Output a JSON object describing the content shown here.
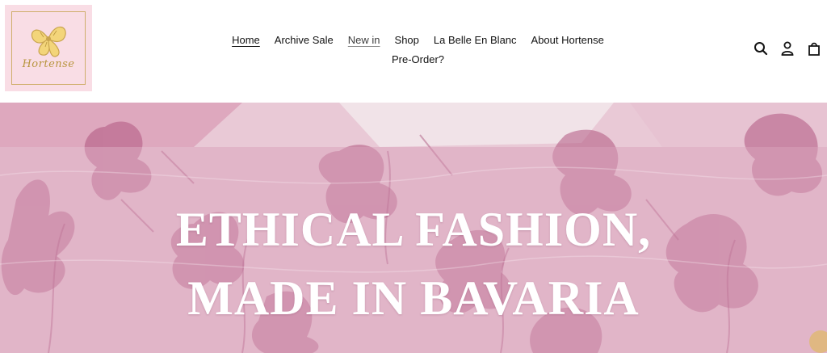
{
  "brand": {
    "logo_text": "Hortense"
  },
  "nav": {
    "items": [
      {
        "label": "Home"
      },
      {
        "label": "Archive Sale"
      },
      {
        "label": "New in"
      },
      {
        "label": "Shop"
      },
      {
        "label": "La Belle En Blanc"
      },
      {
        "label": "About Hortense"
      },
      {
        "label": "Pre-Order?"
      }
    ]
  },
  "header_icons": [
    "search-icon",
    "account-icon",
    "cart-icon"
  ],
  "hero": {
    "line1": "ETHICAL FASHION,",
    "line2": "MADE IN BAVARIA"
  },
  "colors": {
    "logo_bg": "#f9dde5",
    "logo_gold": "#cfae6b",
    "hero_pink": "#d9a7bd",
    "toile_magenta": "#b0557f"
  }
}
